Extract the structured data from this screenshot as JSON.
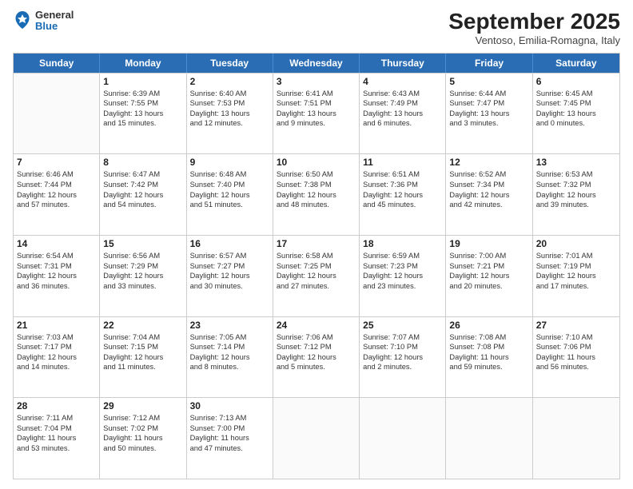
{
  "header": {
    "logo": {
      "general": "General",
      "blue": "Blue"
    },
    "title": "September 2025",
    "location": "Ventoso, Emilia-Romagna, Italy"
  },
  "calendar": {
    "days": [
      "Sunday",
      "Monday",
      "Tuesday",
      "Wednesday",
      "Thursday",
      "Friday",
      "Saturday"
    ],
    "rows": [
      [
        {
          "day": "",
          "lines": []
        },
        {
          "day": "1",
          "lines": [
            "Sunrise: 6:39 AM",
            "Sunset: 7:55 PM",
            "Daylight: 13 hours",
            "and 15 minutes."
          ]
        },
        {
          "day": "2",
          "lines": [
            "Sunrise: 6:40 AM",
            "Sunset: 7:53 PM",
            "Daylight: 13 hours",
            "and 12 minutes."
          ]
        },
        {
          "day": "3",
          "lines": [
            "Sunrise: 6:41 AM",
            "Sunset: 7:51 PM",
            "Daylight: 13 hours",
            "and 9 minutes."
          ]
        },
        {
          "day": "4",
          "lines": [
            "Sunrise: 6:43 AM",
            "Sunset: 7:49 PM",
            "Daylight: 13 hours",
            "and 6 minutes."
          ]
        },
        {
          "day": "5",
          "lines": [
            "Sunrise: 6:44 AM",
            "Sunset: 7:47 PM",
            "Daylight: 13 hours",
            "and 3 minutes."
          ]
        },
        {
          "day": "6",
          "lines": [
            "Sunrise: 6:45 AM",
            "Sunset: 7:45 PM",
            "Daylight: 13 hours",
            "and 0 minutes."
          ]
        }
      ],
      [
        {
          "day": "7",
          "lines": [
            "Sunrise: 6:46 AM",
            "Sunset: 7:44 PM",
            "Daylight: 12 hours",
            "and 57 minutes."
          ]
        },
        {
          "day": "8",
          "lines": [
            "Sunrise: 6:47 AM",
            "Sunset: 7:42 PM",
            "Daylight: 12 hours",
            "and 54 minutes."
          ]
        },
        {
          "day": "9",
          "lines": [
            "Sunrise: 6:48 AM",
            "Sunset: 7:40 PM",
            "Daylight: 12 hours",
            "and 51 minutes."
          ]
        },
        {
          "day": "10",
          "lines": [
            "Sunrise: 6:50 AM",
            "Sunset: 7:38 PM",
            "Daylight: 12 hours",
            "and 48 minutes."
          ]
        },
        {
          "day": "11",
          "lines": [
            "Sunrise: 6:51 AM",
            "Sunset: 7:36 PM",
            "Daylight: 12 hours",
            "and 45 minutes."
          ]
        },
        {
          "day": "12",
          "lines": [
            "Sunrise: 6:52 AM",
            "Sunset: 7:34 PM",
            "Daylight: 12 hours",
            "and 42 minutes."
          ]
        },
        {
          "day": "13",
          "lines": [
            "Sunrise: 6:53 AM",
            "Sunset: 7:32 PM",
            "Daylight: 12 hours",
            "and 39 minutes."
          ]
        }
      ],
      [
        {
          "day": "14",
          "lines": [
            "Sunrise: 6:54 AM",
            "Sunset: 7:31 PM",
            "Daylight: 12 hours",
            "and 36 minutes."
          ]
        },
        {
          "day": "15",
          "lines": [
            "Sunrise: 6:56 AM",
            "Sunset: 7:29 PM",
            "Daylight: 12 hours",
            "and 33 minutes."
          ]
        },
        {
          "day": "16",
          "lines": [
            "Sunrise: 6:57 AM",
            "Sunset: 7:27 PM",
            "Daylight: 12 hours",
            "and 30 minutes."
          ]
        },
        {
          "day": "17",
          "lines": [
            "Sunrise: 6:58 AM",
            "Sunset: 7:25 PM",
            "Daylight: 12 hours",
            "and 27 minutes."
          ]
        },
        {
          "day": "18",
          "lines": [
            "Sunrise: 6:59 AM",
            "Sunset: 7:23 PM",
            "Daylight: 12 hours",
            "and 23 minutes."
          ]
        },
        {
          "day": "19",
          "lines": [
            "Sunrise: 7:00 AM",
            "Sunset: 7:21 PM",
            "Daylight: 12 hours",
            "and 20 minutes."
          ]
        },
        {
          "day": "20",
          "lines": [
            "Sunrise: 7:01 AM",
            "Sunset: 7:19 PM",
            "Daylight: 12 hours",
            "and 17 minutes."
          ]
        }
      ],
      [
        {
          "day": "21",
          "lines": [
            "Sunrise: 7:03 AM",
            "Sunset: 7:17 PM",
            "Daylight: 12 hours",
            "and 14 minutes."
          ]
        },
        {
          "day": "22",
          "lines": [
            "Sunrise: 7:04 AM",
            "Sunset: 7:15 PM",
            "Daylight: 12 hours",
            "and 11 minutes."
          ]
        },
        {
          "day": "23",
          "lines": [
            "Sunrise: 7:05 AM",
            "Sunset: 7:14 PM",
            "Daylight: 12 hours",
            "and 8 minutes."
          ]
        },
        {
          "day": "24",
          "lines": [
            "Sunrise: 7:06 AM",
            "Sunset: 7:12 PM",
            "Daylight: 12 hours",
            "and 5 minutes."
          ]
        },
        {
          "day": "25",
          "lines": [
            "Sunrise: 7:07 AM",
            "Sunset: 7:10 PM",
            "Daylight: 12 hours",
            "and 2 minutes."
          ]
        },
        {
          "day": "26",
          "lines": [
            "Sunrise: 7:08 AM",
            "Sunset: 7:08 PM",
            "Daylight: 11 hours",
            "and 59 minutes."
          ]
        },
        {
          "day": "27",
          "lines": [
            "Sunrise: 7:10 AM",
            "Sunset: 7:06 PM",
            "Daylight: 11 hours",
            "and 56 minutes."
          ]
        }
      ],
      [
        {
          "day": "28",
          "lines": [
            "Sunrise: 7:11 AM",
            "Sunset: 7:04 PM",
            "Daylight: 11 hours",
            "and 53 minutes."
          ]
        },
        {
          "day": "29",
          "lines": [
            "Sunrise: 7:12 AM",
            "Sunset: 7:02 PM",
            "Daylight: 11 hours",
            "and 50 minutes."
          ]
        },
        {
          "day": "30",
          "lines": [
            "Sunrise: 7:13 AM",
            "Sunset: 7:00 PM",
            "Daylight: 11 hours",
            "and 47 minutes."
          ]
        },
        {
          "day": "",
          "lines": []
        },
        {
          "day": "",
          "lines": []
        },
        {
          "day": "",
          "lines": []
        },
        {
          "day": "",
          "lines": []
        }
      ]
    ]
  }
}
